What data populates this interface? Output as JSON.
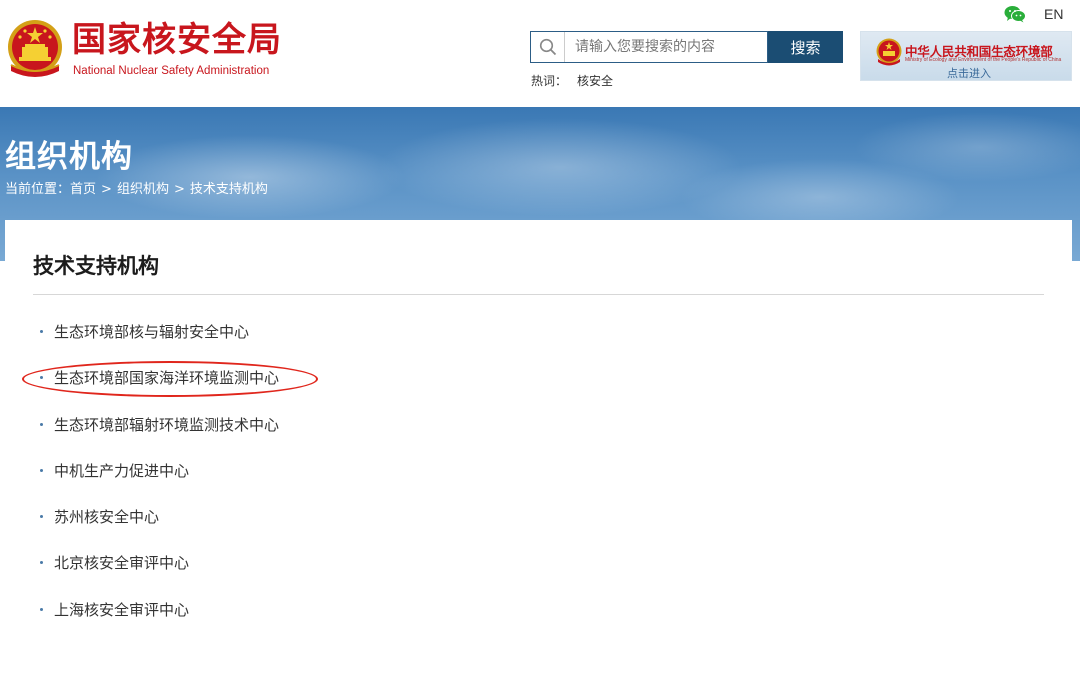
{
  "header": {
    "logo_title": "国家核安全局",
    "logo_subtitle": "National Nuclear Safety Administration",
    "search": {
      "placeholder": "请输入您要搜索的内容",
      "button_label": "搜索"
    },
    "hot_words": {
      "label": "热词：",
      "items": [
        "核安全"
      ]
    },
    "ministry_link": {
      "title": "中华人民共和国生态环境部",
      "subtitle": "Ministry of Ecology and Environment of the People's Republic of China",
      "enter_label": "点击进入"
    },
    "language_label": "EN",
    "icons": {
      "wechat": "wechat-icon",
      "search": "search-icon",
      "emblem": "national-emblem-icon"
    }
  },
  "banner": {
    "title": "组织机构",
    "breadcrumb": {
      "prefix": "当前位置：",
      "items": [
        "首页",
        "组织机构",
        "技术支持机构"
      ],
      "separator": ">"
    }
  },
  "content": {
    "title": "技术支持机构",
    "items": [
      "生态环境部核与辐射安全中心",
      "生态环境部国家海洋环境监测中心",
      "生态环境部辐射环境监测技术中心",
      "中机生产力促进中心",
      "苏州核安全中心",
      "北京核安全审评中心",
      "上海核安全审评中心"
    ],
    "highlighted_index": 1
  },
  "colors": {
    "brand_red": "#c8161d",
    "search_button": "#1b4d73",
    "banner_blue": "#3a78b4",
    "highlight_circle": "#e0261c"
  }
}
